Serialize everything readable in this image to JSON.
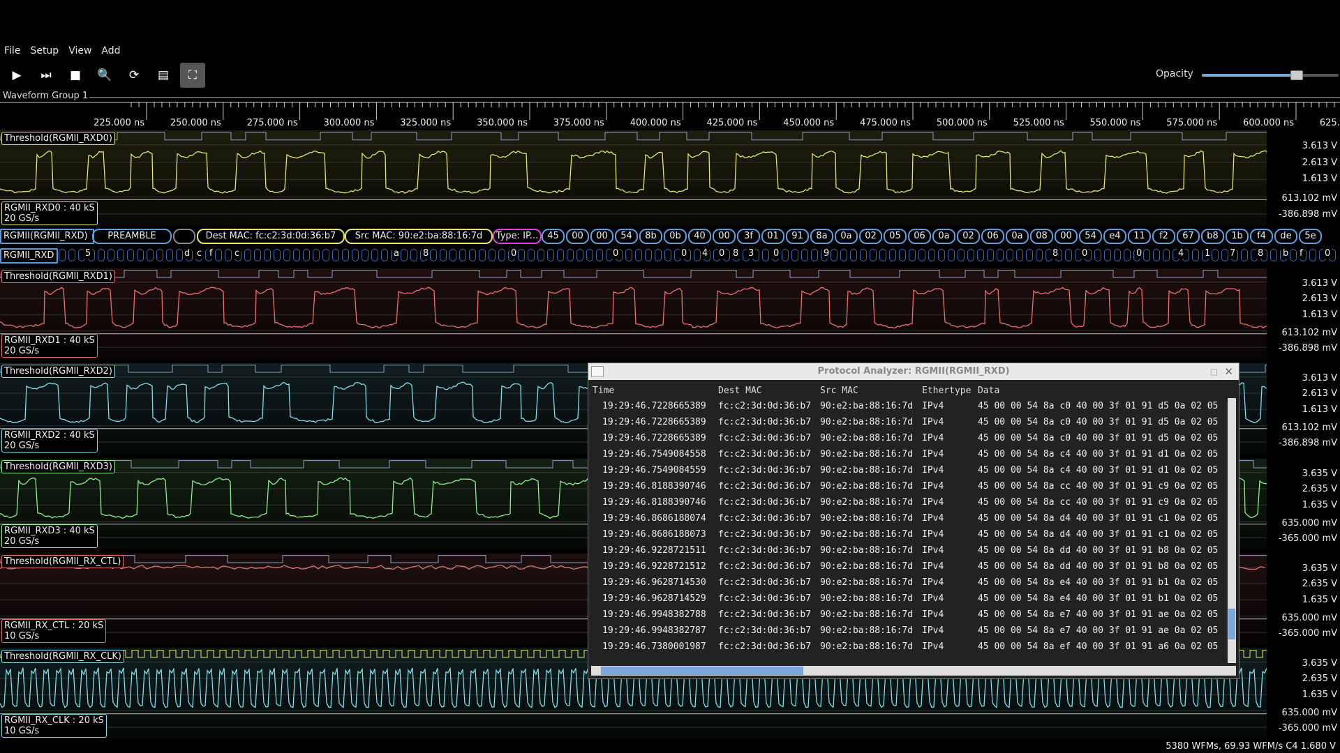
{
  "menu": [
    "File",
    "Setup",
    "View",
    "Add"
  ],
  "toolbar": {
    "buttons": [
      {
        "name": "play-icon",
        "glyph": "▶"
      },
      {
        "name": "step-icon",
        "glyph": "⏭"
      },
      {
        "name": "stop-icon",
        "glyph": "■"
      },
      {
        "name": "zoom-icon",
        "glyph": "🔍"
      },
      {
        "name": "refresh-icon",
        "glyph": "⟳"
      },
      {
        "name": "history-icon",
        "glyph": "▤"
      },
      {
        "name": "fullscreen-icon",
        "glyph": "⛶"
      }
    ],
    "opacity_label": "Opacity",
    "opacity_value": 0.69
  },
  "group_title": "Waveform Group 1",
  "time_ticks": [
    "225.000 ns",
    "250.000 ns",
    "275.000 ns",
    "300.000 ns",
    "325.000 ns",
    "350.000 ns",
    "375.000 ns",
    "400.000 ns",
    "425.000 ns",
    "450.000 ns",
    "475.000 ns",
    "500.000 ns",
    "525.000 ns",
    "550.000 ns",
    "575.000 ns",
    "600.000 ns",
    "625.000 ns"
  ],
  "lanes": [
    {
      "threshold": "Threshold(RGMII_RXD0)",
      "name": "RGMII_RXD0 : 40 kS",
      "rate": "20 GS/s",
      "color": "#e6e66a",
      "volts": [
        "3.613 V",
        "2.613 V",
        "1.613 V",
        "613.102 mV",
        "-386.898 mV"
      ]
    },
    {
      "threshold": "Threshold(RGMII_RXD1)",
      "name": "RGMII_RXD1 : 40 kS",
      "rate": "20 GS/s",
      "color": "#ef6f6f",
      "volts": [
        "3.613 V",
        "2.613 V",
        "1.613 V",
        "613.102 mV",
        "-386.898 mV"
      ]
    },
    {
      "threshold": "Threshold(RGMII_RXD2)",
      "name": "RGMII_RXD2 : 40 kS",
      "rate": "20 GS/s",
      "color": "#7fe0ec",
      "volts": [
        "3.613 V",
        "2.613 V",
        "1.613 V",
        "613.102 mV",
        "-386.898 mV"
      ]
    },
    {
      "threshold": "Threshold(RGMII_RXD3)",
      "name": "RGMII_RXD3 : 40 kS",
      "rate": "20 GS/s",
      "color": "#8cf08c",
      "volts": [
        "3.635 V",
        "2.635 V",
        "1.635 V",
        "635.000 mV",
        "-365.000 mV"
      ]
    },
    {
      "threshold": "Threshold(RGMII_RX_CTL)",
      "name": "RGMII_RX_CTL : 20 kS",
      "rate": "10 GS/s",
      "color": "#e07070",
      "volts": [
        "3.635 V",
        "2.635 V",
        "1.635 V",
        "635.000 mV",
        "-365.000 mV"
      ]
    },
    {
      "threshold": "Threshold(RGMII_RX_CLK)",
      "name": "RGMII_RX_CLK : 20 kS",
      "rate": "10 GS/s",
      "color": "#7fe0ec",
      "volts": [
        "3.635 V",
        "2.635 V",
        "1.635 V",
        "635.000 mV",
        "-365.000 mV"
      ]
    }
  ],
  "protocol_row": {
    "label": "RGMII(RGMII_RXD)",
    "preamble": "PREAMBLE",
    "dest": "Dest MAC: fc:c2:3d:0d:36:b7",
    "src": "Src MAC: 90:e2:ba:88:16:7d",
    "type": "Type: IP...",
    "bytes": [
      "45",
      "00",
      "00",
      "54",
      "8b",
      "0b",
      "40",
      "00",
      "3f",
      "01",
      "91",
      "8a",
      "0a",
      "02",
      "05",
      "06",
      "0a",
      "02",
      "06",
      "0a",
      "08",
      "00",
      "54",
      "e4",
      "11",
      "f2",
      "67",
      "b8",
      "1b",
      "f4",
      "de",
      "5e"
    ]
  },
  "nibble_row": {
    "label": "RGMII_RXD",
    "values": [
      "5",
      "d",
      "c",
      "f",
      "c",
      "a",
      "8",
      "0",
      "0",
      "4",
      "8",
      "0",
      "0",
      "3",
      "0",
      "9",
      "8",
      "0",
      "0",
      "4",
      "1",
      "7",
      "8",
      "b",
      "f",
      "0"
    ]
  },
  "analyzer": {
    "title": "Protocol Analyzer: RGMII(RGMII_RXD)",
    "columns": [
      "Time",
      "Dest MAC",
      "Src MAC",
      "Ethertype",
      "Data"
    ],
    "rows": [
      [
        "19:29:46.7228665389",
        "fc:c2:3d:0d:36:b7",
        "90:e2:ba:88:16:7d",
        "IPv4",
        "45 00 00 54 8a c0 40 00 3f 01 91 d5 0a 02 05"
      ],
      [
        "19:29:46.7228665389",
        "fc:c2:3d:0d:36:b7",
        "90:e2:ba:88:16:7d",
        "IPv4",
        "45 00 00 54 8a c0 40 00 3f 01 91 d5 0a 02 05"
      ],
      [
        "19:29:46.7228665389",
        "fc:c2:3d:0d:36:b7",
        "90:e2:ba:88:16:7d",
        "IPv4",
        "45 00 00 54 8a c0 40 00 3f 01 91 d5 0a 02 05"
      ],
      [
        "19:29:46.7549084558",
        "fc:c2:3d:0d:36:b7",
        "90:e2:ba:88:16:7d",
        "IPv4",
        "45 00 00 54 8a c4 40 00 3f 01 91 d1 0a 02 05"
      ],
      [
        "19:29:46.7549084559",
        "fc:c2:3d:0d:36:b7",
        "90:e2:ba:88:16:7d",
        "IPv4",
        "45 00 00 54 8a c4 40 00 3f 01 91 d1 0a 02 05"
      ],
      [
        "19:29:46.8188390746",
        "fc:c2:3d:0d:36:b7",
        "90:e2:ba:88:16:7d",
        "IPv4",
        "45 00 00 54 8a cc 40 00 3f 01 91 c9 0a 02 05"
      ],
      [
        "19:29:46.8188390746",
        "fc:c2:3d:0d:36:b7",
        "90:e2:ba:88:16:7d",
        "IPv4",
        "45 00 00 54 8a cc 40 00 3f 01 91 c9 0a 02 05"
      ],
      [
        "19:29:46.8686188074",
        "fc:c2:3d:0d:36:b7",
        "90:e2:ba:88:16:7d",
        "IPv4",
        "45 00 00 54 8a d4 40 00 3f 01 91 c1 0a 02 05"
      ],
      [
        "19:29:46.8686188073",
        "fc:c2:3d:0d:36:b7",
        "90:e2:ba:88:16:7d",
        "IPv4",
        "45 00 00 54 8a d4 40 00 3f 01 91 c1 0a 02 05"
      ],
      [
        "19:29:46.9228721511",
        "fc:c2:3d:0d:36:b7",
        "90:e2:ba:88:16:7d",
        "IPv4",
        "45 00 00 54 8a dd 40 00 3f 01 91 b8 0a 02 05"
      ],
      [
        "19:29:46.9228721512",
        "fc:c2:3d:0d:36:b7",
        "90:e2:ba:88:16:7d",
        "IPv4",
        "45 00 00 54 8a dd 40 00 3f 01 91 b8 0a 02 05"
      ],
      [
        "19:29:46.9628714530",
        "fc:c2:3d:0d:36:b7",
        "90:e2:ba:88:16:7d",
        "IPv4",
        "45 00 00 54 8a e4 40 00 3f 01 91 b1 0a 02 05"
      ],
      [
        "19:29:46.9628714529",
        "fc:c2:3d:0d:36:b7",
        "90:e2:ba:88:16:7d",
        "IPv4",
        "45 00 00 54 8a e4 40 00 3f 01 91 b1 0a 02 05"
      ],
      [
        "19:29:46.9948382788",
        "fc:c2:3d:0d:36:b7",
        "90:e2:ba:88:16:7d",
        "IPv4",
        "45 00 00 54 8a e7 40 00 3f 01 91 ae 0a 02 05"
      ],
      [
        "19:29:46.9948382787",
        "fc:c2:3d:0d:36:b7",
        "90:e2:ba:88:16:7d",
        "IPv4",
        "45 00 00 54 8a e7 40 00 3f 01 91 ae 0a 02 05"
      ],
      [
        "19:29:46.7380001987",
        "fc:c2:3d:0d:36:b7",
        "90:e2:ba:88:16:7d",
        "IPv4",
        "45 00 00 54 8a ef 40 00 3f 01 91 a6 0a 02 05"
      ]
    ],
    "scroll_fraction": 0.9
  },
  "status": "5380 WFMs, 69.93 WFM/s  C4 1.680 V"
}
